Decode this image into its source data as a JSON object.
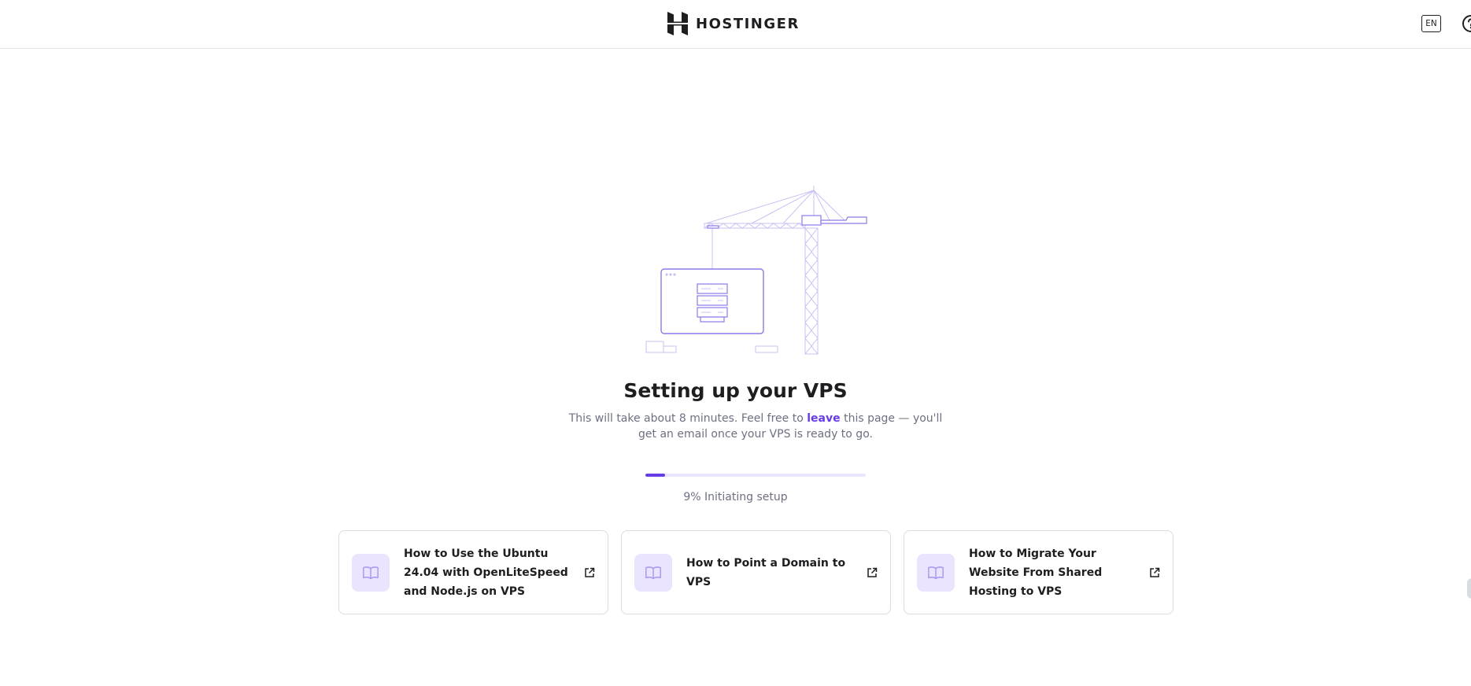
{
  "header": {
    "brand": "HOSTINGER",
    "language": "EN"
  },
  "setup": {
    "title": "Setting up your VPS",
    "subtitle_before": "This will take about 8 minutes. Feel free to ",
    "subtitle_link": "leave",
    "subtitle_after": " this page — you'll get an email once your VPS is ready to go.",
    "progress_percent": 9,
    "progress_label": "9% Initiating setup"
  },
  "articles": [
    {
      "title": "How to Use the Ubuntu 24.04 with OpenLiteSpeed and Node.js on VPS",
      "icon": "book-icon"
    },
    {
      "title": "How to Point a Domain to VPS",
      "icon": "book-icon"
    },
    {
      "title": "How to Migrate Your Website From Shared Hosting to VPS",
      "icon": "book-icon"
    }
  ],
  "colors": {
    "accent": "#673de6",
    "accent_light": "#ebe4ff",
    "text": "#1d1e20",
    "muted": "#6d7081"
  }
}
